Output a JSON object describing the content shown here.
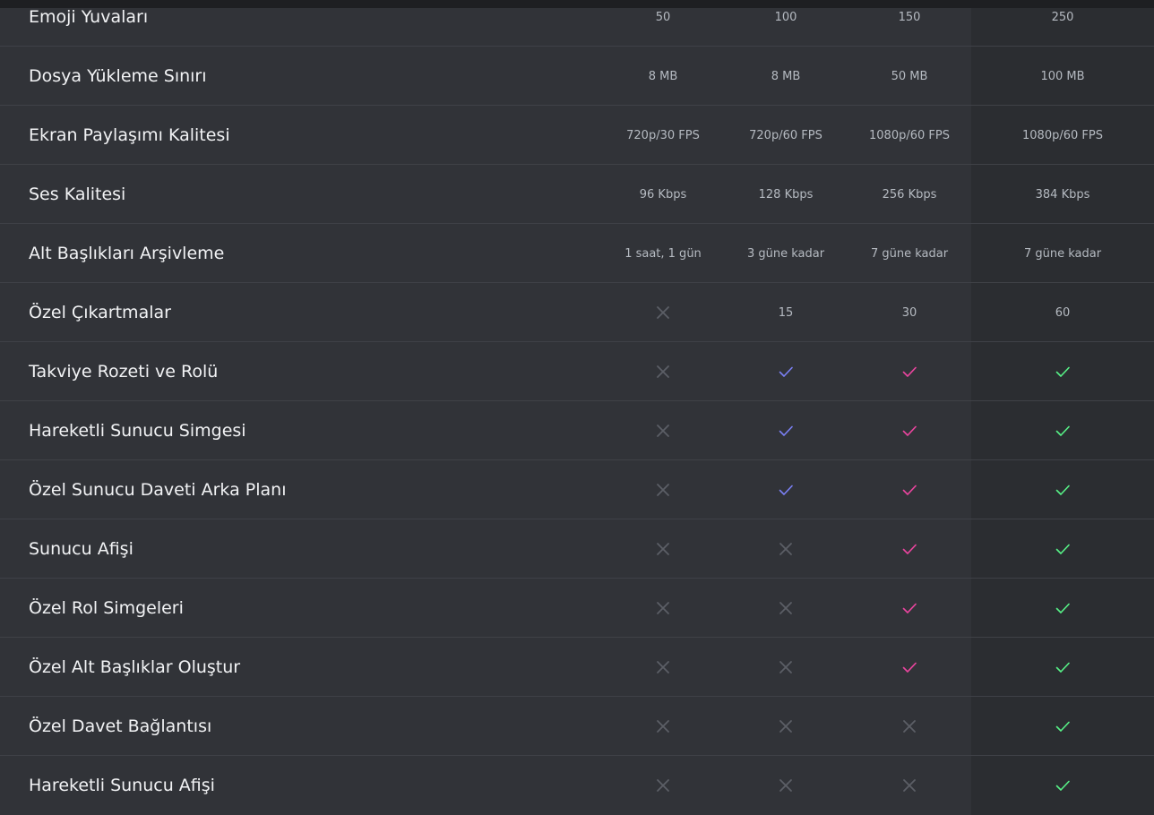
{
  "colors": {
    "cross": "#5c5f66",
    "tier1_check": "#7b80f5",
    "tier2_check": "#eb459f",
    "tier3_check": "#57f287"
  },
  "rows": [
    {
      "label": "Emoji Yuvaları",
      "cells": [
        {
          "text": "50"
        },
        {
          "text": "100"
        },
        {
          "text": "150"
        },
        {
          "text": "250"
        }
      ]
    },
    {
      "label": "Dosya Yükleme Sınırı",
      "cells": [
        {
          "text": "8 MB"
        },
        {
          "text": "8 MB"
        },
        {
          "text": "50 MB"
        },
        {
          "text": "100 MB"
        }
      ]
    },
    {
      "label": "Ekran Paylaşımı Kalitesi",
      "cells": [
        {
          "text": "720p/30 FPS"
        },
        {
          "text": "720p/60 FPS"
        },
        {
          "text": "1080p/60 FPS"
        },
        {
          "text": "1080p/60 FPS"
        }
      ]
    },
    {
      "label": "Ses Kalitesi",
      "cells": [
        {
          "text": "96 Kbps"
        },
        {
          "text": "128 Kbps"
        },
        {
          "text": "256 Kbps"
        },
        {
          "text": "384 Kbps"
        }
      ]
    },
    {
      "label": "Alt Başlıkları Arşivleme",
      "cells": [
        {
          "text": "1 saat, 1 gün"
        },
        {
          "text": "3 güne kadar"
        },
        {
          "text": "7 güne kadar"
        },
        {
          "text": "7 güne kadar"
        }
      ]
    },
    {
      "label": "Özel Çıkartmalar",
      "cells": [
        {
          "icon": "cross"
        },
        {
          "text": "15"
        },
        {
          "text": "30"
        },
        {
          "text": "60"
        }
      ]
    },
    {
      "label": "Takviye Rozeti ve Rolü",
      "cells": [
        {
          "icon": "cross"
        },
        {
          "icon": "check"
        },
        {
          "icon": "check"
        },
        {
          "icon": "check"
        }
      ]
    },
    {
      "label": "Hareketli Sunucu Simgesi",
      "cells": [
        {
          "icon": "cross"
        },
        {
          "icon": "check"
        },
        {
          "icon": "check"
        },
        {
          "icon": "check"
        }
      ]
    },
    {
      "label": "Özel Sunucu Daveti Arka Planı",
      "cells": [
        {
          "icon": "cross"
        },
        {
          "icon": "check"
        },
        {
          "icon": "check"
        },
        {
          "icon": "check"
        }
      ]
    },
    {
      "label": "Sunucu Afişi",
      "cells": [
        {
          "icon": "cross"
        },
        {
          "icon": "cross"
        },
        {
          "icon": "check"
        },
        {
          "icon": "check"
        }
      ]
    },
    {
      "label": "Özel Rol Simgeleri",
      "cells": [
        {
          "icon": "cross"
        },
        {
          "icon": "cross"
        },
        {
          "icon": "check"
        },
        {
          "icon": "check"
        }
      ]
    },
    {
      "label": "Özel Alt Başlıklar Oluştur",
      "cells": [
        {
          "icon": "cross"
        },
        {
          "icon": "cross"
        },
        {
          "icon": "check"
        },
        {
          "icon": "check"
        }
      ]
    },
    {
      "label": "Özel Davet Bağlantısı",
      "cells": [
        {
          "icon": "cross"
        },
        {
          "icon": "cross"
        },
        {
          "icon": "cross"
        },
        {
          "icon": "check"
        }
      ]
    },
    {
      "label": "Hareketli Sunucu Afişi",
      "cells": [
        {
          "icon": "cross"
        },
        {
          "icon": "cross"
        },
        {
          "icon": "cross"
        },
        {
          "icon": "check"
        }
      ]
    }
  ]
}
